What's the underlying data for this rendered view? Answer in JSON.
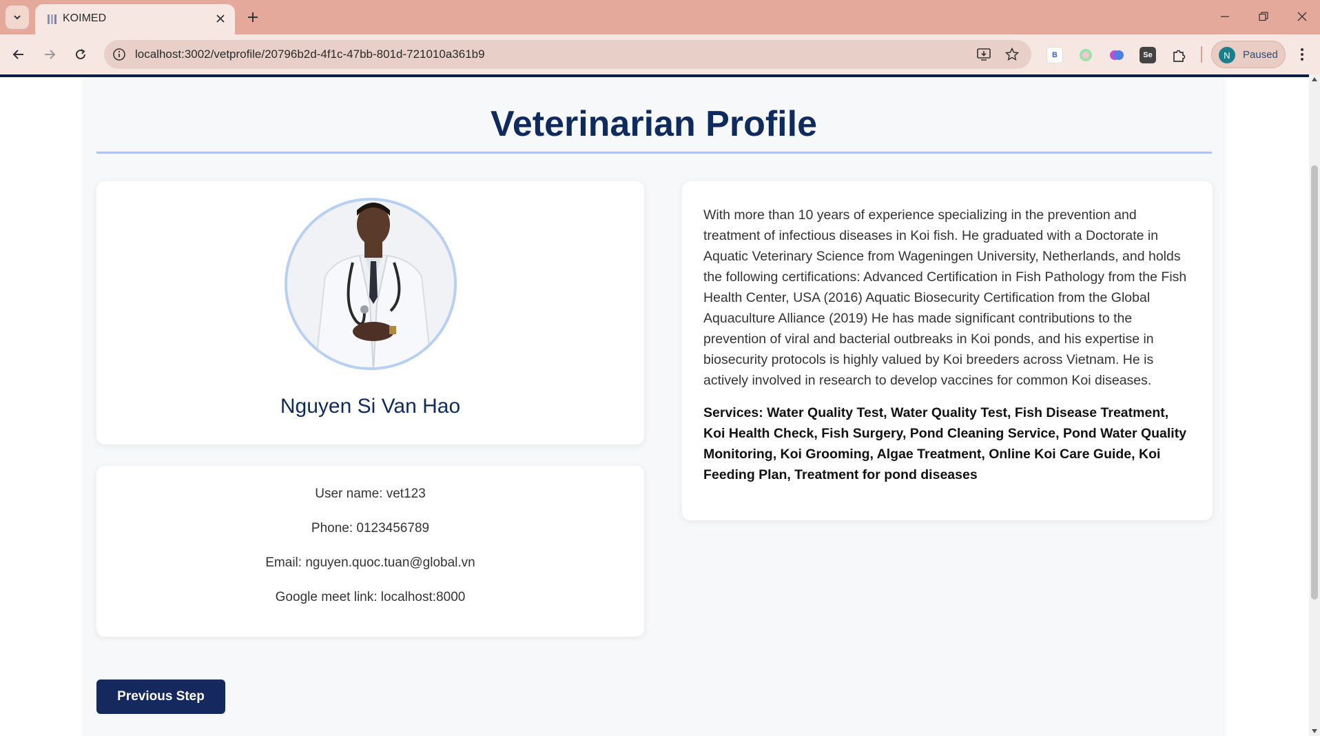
{
  "browser": {
    "tab_title": "KOIMED",
    "url": "localhost:3002/vetprofile/20796b2d-4f1c-47bb-801d-721010a361b9",
    "profile_initial": "N",
    "profile_status": "Paused",
    "extension_b_label": "B",
    "extension_se_label": "Se"
  },
  "page": {
    "title": "Veterinarian Profile",
    "vet_name": "Nguyen Si Van Hao",
    "info": {
      "username": "User name: vet123",
      "phone": "Phone: 0123456789",
      "email": "Email: nguyen.quoc.tuan@global.vn",
      "meet_link": "Google meet link: localhost:8000"
    },
    "bio": "With more than 10 years of experience specializing in the prevention and treatment of infectious diseases in Koi fish. He graduated with a Doctorate in Aquatic Veterinary Science from Wageningen University, Netherlands, and holds the following certifications: Advanced Certification in Fish Pathology from the Fish Health Center, USA (2016) Aquatic Biosecurity Certification from the Global Aquaculture Alliance (2019) He has made significant contributions to the prevention of viral and bacterial outbreaks in Koi ponds, and his expertise in biosecurity protocols is highly valued by Koi breeders across Vietnam. He is actively involved in research to develop vaccines for common Koi diseases.",
    "services": "Services: Water Quality Test, Water Quality Test, Fish Disease Treatment, Koi Health Check, Fish Surgery, Pond Cleaning Service, Pond Water Quality Monitoring, Koi Grooming, Algae Treatment, Online Koi Care Guide, Koi Feeding Plan, Treatment for pond diseases",
    "prev_button": "Previous Step"
  },
  "colors": {
    "tabbar": "#e4a99a",
    "toolbar": "#f6e7e2",
    "heading": "#0f2a5c",
    "button": "#16295e",
    "accent_rule": "#a9c7ef"
  }
}
